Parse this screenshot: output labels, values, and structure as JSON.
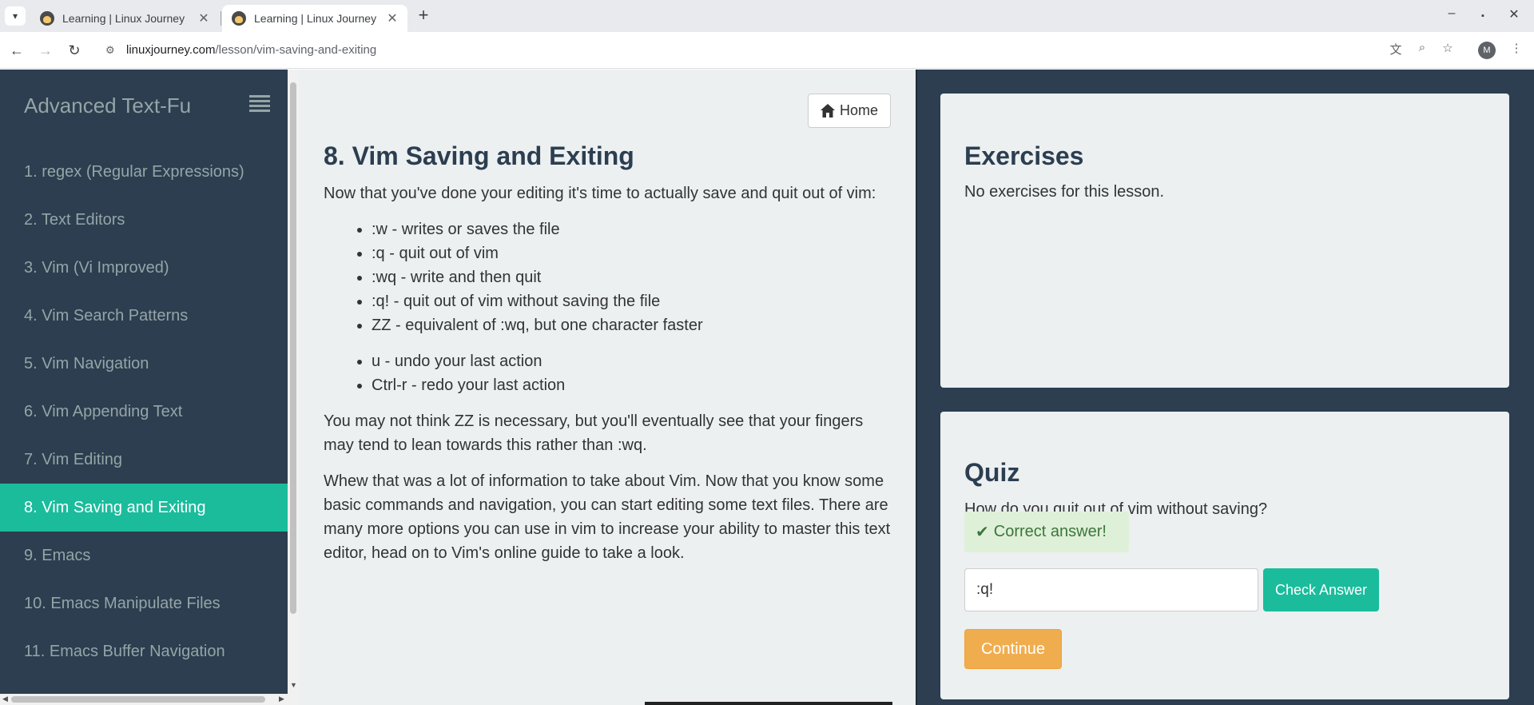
{
  "browser": {
    "tabs": [
      {
        "title": "Learning | Linux Journey",
        "active": false
      },
      {
        "title": "Learning | Linux Journey",
        "active": true
      }
    ],
    "url_host": "linuxjourney.com",
    "url_path": "/lesson/vim-saving-and-exiting",
    "profile_initial": "M"
  },
  "sidebar": {
    "title": "Advanced Text-Fu",
    "items": [
      "1. regex (Regular Expressions)",
      "2. Text Editors",
      "3. Vim (Vi Improved)",
      "4. Vim Search Patterns",
      "5. Vim Navigation",
      "6. Vim Appending Text",
      "7. Vim Editing",
      "8. Vim Saving and Exiting",
      "9. Emacs",
      "10. Emacs Manipulate Files",
      "11. Emacs Buffer Navigation"
    ],
    "active_index": 7
  },
  "lesson": {
    "home_label": "Home",
    "title": "8. Vim Saving and Exiting",
    "intro": "Now that you've done your editing it's time to actually save and quit out of vim:",
    "commands": [
      ":w - writes or saves the file",
      ":q - quit out of vim",
      ":wq - write and then quit",
      ":q! - quit out of vim without saving the file",
      "ZZ - equivalent of :wq, but one character faster"
    ],
    "undo_commands": [
      "u - undo your last action",
      "Ctrl-r - redo your last action"
    ],
    "para2": "You may not think ZZ is necessary, but you'll eventually see that your fingers may tend to lean towards this rather than :wq.",
    "para3": "Whew that was a lot of information to take about Vim. Now that you know some basic commands and navigation, you can start editing some text files. There are many more options you can use in vim to increase your ability to master this text editor, head on to Vim's online guide to take a look."
  },
  "exercises": {
    "title": "Exercises",
    "note": "No exercises for this lesson."
  },
  "quiz": {
    "title": "Quiz",
    "question": "How do you quit out of vim without saving?",
    "feedback": "Correct answer!",
    "answer_value": ":q!",
    "check_label": "Check Answer",
    "continue_label": "Continue"
  },
  "colors": {
    "sidebar_bg": "#2c3e50",
    "accent": "#1abc9c",
    "warning": "#f0ad4e",
    "success_bg": "#dff0d8"
  }
}
